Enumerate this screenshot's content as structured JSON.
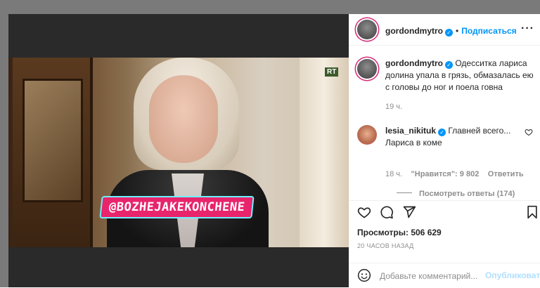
{
  "post": {
    "username": "gordondmytro",
    "follow_label": "Подписаться",
    "caption": "Одесситка лариса долина упала в грязь, обмазалась ею с головы до ног и поела говна",
    "caption_time": "19 ч."
  },
  "media": {
    "watermark": "RT",
    "sticker_text": "@BOZHEJAKEKONCHENE"
  },
  "comment": {
    "username": "lesia_nikituk",
    "text_line1": "Главней всего...",
    "text_line2": "Лариса в коме",
    "time": "18 ч.",
    "likes": "\"Нравится\": 9 802",
    "reply_label": "Ответить",
    "view_replies": "Посмотреть ответы (174)"
  },
  "stats": {
    "views": "Просмотры: 506 629",
    "timestamp": "20 ЧАСОВ НАЗАД"
  },
  "composer": {
    "placeholder": "Добавьте комментарий...",
    "publish_label": "Опубликовать"
  },
  "icons": [
    "more-icon",
    "heart-icon",
    "comment-icon",
    "share-icon",
    "bookmark-icon",
    "emoji-icon",
    "like-comment-icon",
    "verified-icon"
  ],
  "colors": {
    "accent": "#0095f6",
    "text": "#262626",
    "muted": "#8e8e8e",
    "overlay": "#7a7a7a",
    "sticker": "#e8246c"
  }
}
